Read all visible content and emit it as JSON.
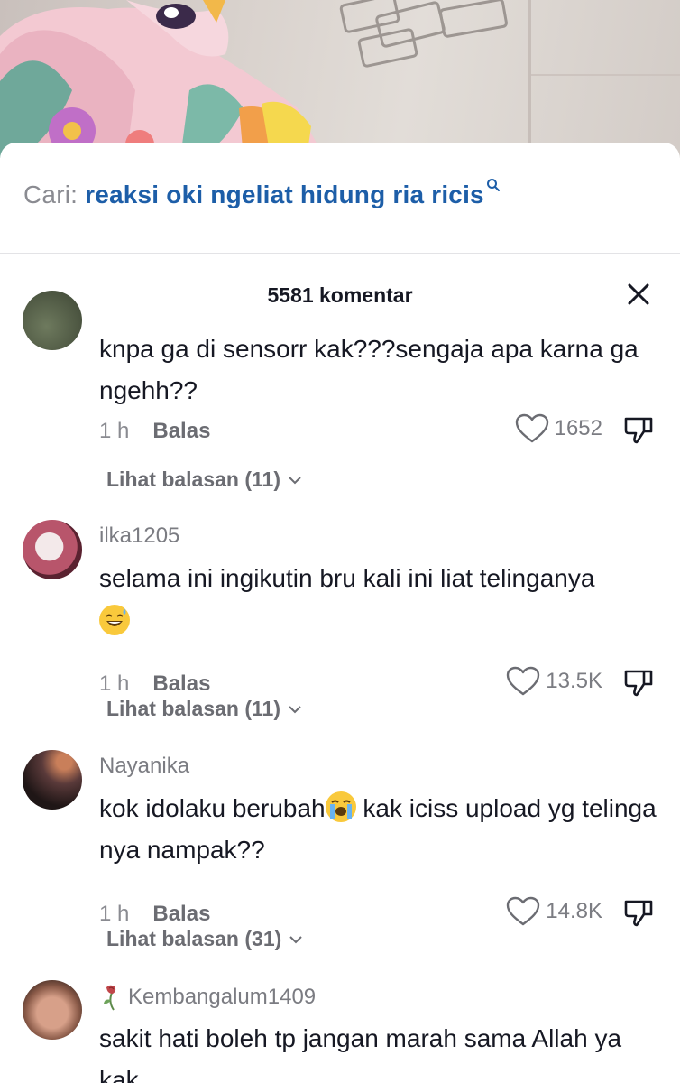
{
  "search": {
    "prefix": "Cari:",
    "query": "reaksi oki ngeliat hidung ria ricis"
  },
  "header": {
    "title": "5581 komentar"
  },
  "comments": [
    {
      "username": "",
      "text": "knpa ga di sensorr kak???sengaja apa karna ga ngehh??",
      "time": "1 h",
      "reply_label": "Balas",
      "likes": "1652",
      "view_replies": "Lihat balasan (11)"
    },
    {
      "username": "ilka1205",
      "text": "selama ini ingikutin bru kali ini liat telinganya",
      "emoji": "grinning-sweat-emoji",
      "time": "1 h",
      "reply_label": "Balas",
      "likes": "13.5K",
      "view_replies": "Lihat balasan (11)"
    },
    {
      "username": "Nayanika",
      "text_before_emoji": "kok idolaku berubah",
      "emoji": "crying-emoji",
      "text_after_emoji": " kak iciss upload yg telinga nya nampak??",
      "time": "1 h",
      "reply_label": "Balas",
      "likes": "14.8K",
      "view_replies": "Lihat balasan (31)"
    },
    {
      "username": "Kembangalum1409",
      "username_icon": "wilted-rose-icon",
      "text": "sakit hati boleh tp jangan marah sama Allah ya kak"
    }
  ],
  "colors": {
    "query_blue": "#1d5ea8",
    "text_dark": "#161823",
    "text_gray": "#8a8b91"
  }
}
